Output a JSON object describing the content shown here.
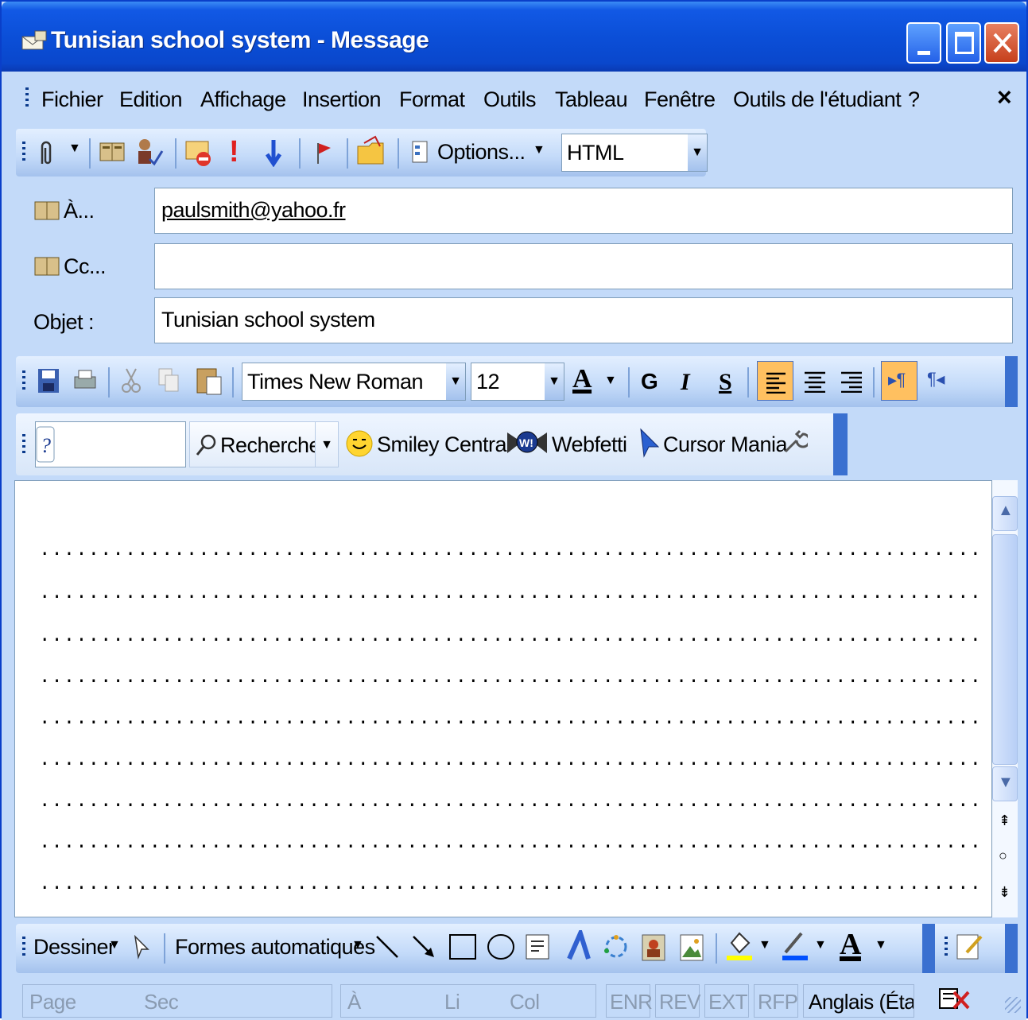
{
  "window": {
    "title": "Tunisian school system - Message"
  },
  "menu": [
    "Fichier",
    "Edition",
    "Affichage",
    "Insertion",
    "Format",
    "Outils",
    "Tableau",
    "Fenêtre",
    "Outils de l'étudiant",
    "?"
  ],
  "menu_close": "×",
  "toolbar": {
    "options_label": "Options...",
    "format_value": "HTML"
  },
  "fields": {
    "to_label": "À...",
    "to_value": "paulsmith@yahoo.fr",
    "cc_label": "Cc...",
    "cc_value": "",
    "subject_label": "Objet :",
    "subject_value": "Tunisian school system"
  },
  "format_toolbar": {
    "font": "Times New Roman",
    "size": "12",
    "bold": "G",
    "italic": "I",
    "underline": "S"
  },
  "search_toolbar": {
    "search_label": "Recherche",
    "smiley": "Smiley Central",
    "webfetti": "Webfetti",
    "cursor": "Cursor Mania"
  },
  "body": {
    "dotted_line": "..................................................................................................."
  },
  "draw_toolbar": {
    "draw": "Dessiner",
    "autoshapes": "Formes automatiques"
  },
  "status": {
    "page": "Page",
    "sec": "Sec",
    "at": "À",
    "li": "Li",
    "col": "Col",
    "enr": "ENR",
    "rev": "REV",
    "ext": "EXT",
    "rfp": "RFP",
    "lang": "Anglais (Éta"
  }
}
